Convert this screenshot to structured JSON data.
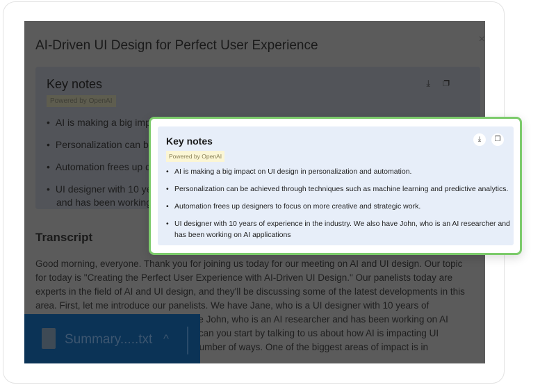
{
  "dialog": {
    "title": "AI-Driven UI Design for Perfect User Experience",
    "close": "×"
  },
  "keynotes": {
    "title": "Key notes",
    "badge": "Powered by OpenAI",
    "download_icon": "⤓",
    "copy_icon": "❐",
    "items": [
      "AI is making a big impact on UI design in personalization and automation.",
      "Personalization can be achieved through techniques such as machine learning and predictive analytics.",
      "Automation frees up designers to focus on more creative and strategic work.",
      "UI designer with 10 years of experience in the industry. We also have John, who is an AI researcher and has been working on AI applications"
    ]
  },
  "bg_items": [
    "AI is making a big impact",
    "Personalization can be",
    "Automation frees up d",
    "UI designer with 10 yea"
  ],
  "bg_item4_line2": "and has been working o",
  "transcript": {
    "title": "Transcript",
    "text": "Good morning, everyone. Thank you for joining us today for our meeting on AI and UI design. Our topic for today is \"Creating the Perfect User Experience with AI-Driven UI Design.\" Our panelists today are experts in the field of AI and UI design, and they'll be discussing some of the latest developments in this area. First, let me introduce our panelists. We have Jane, who is a UI designer with 10 years of experience in the industry. We also have John, who is an AI researcher and has been working on AI applications for the past 5 years. Jane, can you start by talking to us about how AI is impacting UI design? AI is impacting UI design in a number of ways. One of the biggest areas of impact is in"
  },
  "download": {
    "filename": "Summary.....txt",
    "chevron": "^"
  },
  "colors": {
    "accent": "#7ccb6b",
    "panel": "#e7eef9",
    "download_bar": "#0b3356"
  }
}
